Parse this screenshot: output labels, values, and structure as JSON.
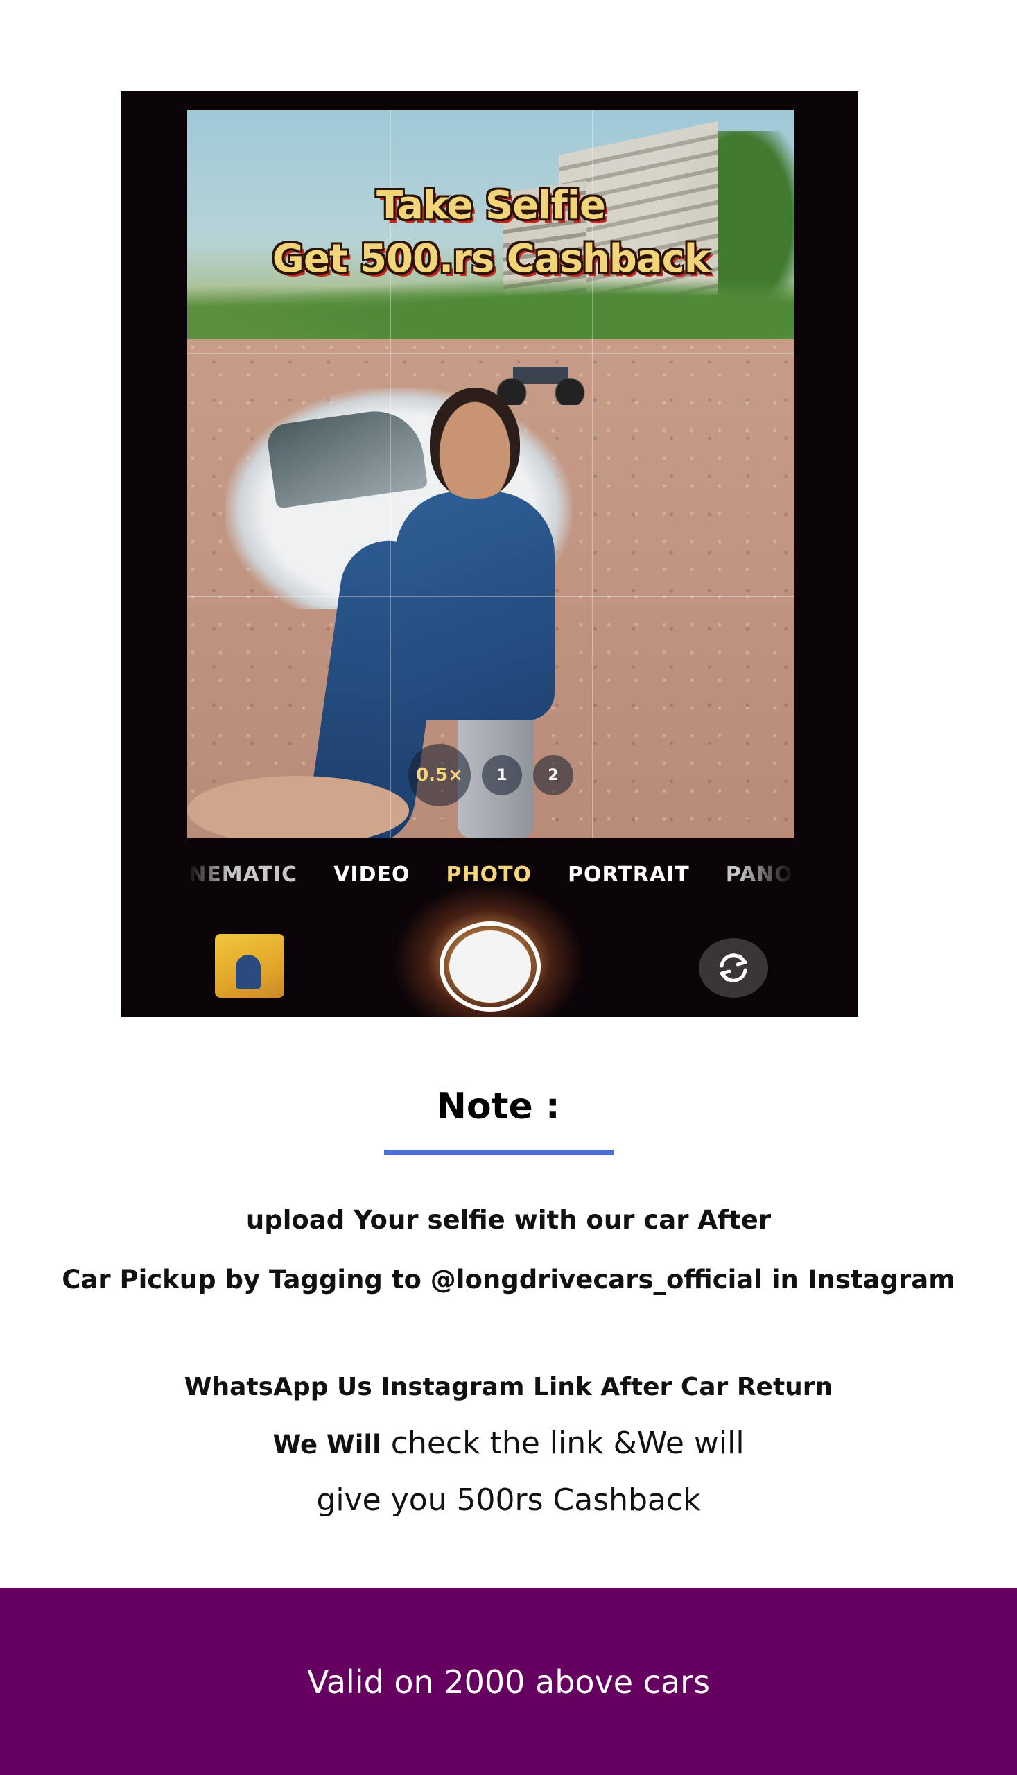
{
  "camera": {
    "overlay_line1": "Take Selfie",
    "overlay_line2": "Get 500.rs Cashback",
    "zoom_levels": [
      "0.5×",
      "1",
      "2"
    ],
    "modes": [
      "NEMATIC",
      "VIDEO",
      "PHOTO",
      "PORTRAIT",
      "PANO"
    ],
    "active_mode": "PHOTO",
    "icons": {
      "gallery": "gallery-thumbnail",
      "shutter": "shutter-button",
      "flip": "camera-flip-icon"
    },
    "accent_color": "#f6d57c"
  },
  "note": {
    "title": "Note :",
    "line1": "upload Your selfie with our car  After",
    "line2": "Car Pickup by Tagging to @longdrivecars_official in Instagram",
    "line3": "WhatsApp Us Instagram Link After Car Return",
    "line4_lead": "We Will",
    "line4_rest": " check the link &We will",
    "line5": "give you 500rs Cashback",
    "underline_color": "#4a6fd8"
  },
  "footer": {
    "text": "Valid on 2000 above cars",
    "background": "#650060"
  }
}
